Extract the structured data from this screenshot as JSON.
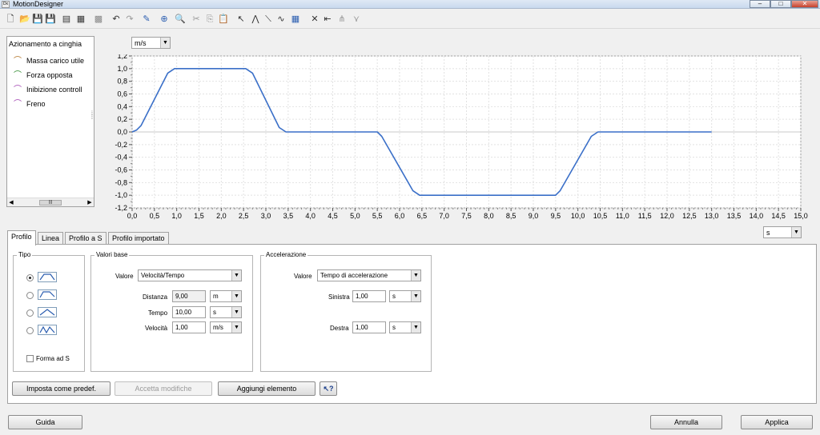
{
  "window": {
    "title": "MotionDesigner"
  },
  "tree": {
    "header": "Azionamento a cinghia",
    "items": [
      {
        "label": "Massa carico utile",
        "color": "#b07020"
      },
      {
        "label": "Forza opposta",
        "color": "#2c8a2c"
      },
      {
        "label": "Inibizione controll",
        "color": "#a040b0"
      },
      {
        "label": "Freno",
        "color": "#a040b0"
      }
    ]
  },
  "unit_select": {
    "value": "m/s"
  },
  "time_unit_select": {
    "value": "s"
  },
  "chart_data": {
    "type": "line",
    "x_ticks": [
      "0,0",
      "0,5",
      "1,0",
      "1,5",
      "2,0",
      "2,5",
      "3,0",
      "3,5",
      "4,0",
      "4,5",
      "5,0",
      "5,5",
      "6,0",
      "6,5",
      "7,0",
      "7,5",
      "8,0",
      "8,5",
      "9,0",
      "9,5",
      "10,0",
      "10,5",
      "11,0",
      "11,5",
      "12,0",
      "12,5",
      "13,0",
      "13,5",
      "14,0",
      "14,5",
      "15,0"
    ],
    "y_ticks": [
      "1,2",
      "1,0",
      "0,8",
      "0,6",
      "0,4",
      "0,2",
      "0,0",
      "-0,2",
      "-0,4",
      "-0,6",
      "-0,8",
      "-1,0",
      "-1,2"
    ],
    "xlim": [
      0,
      15
    ],
    "ylim": [
      -1.2,
      1.2
    ],
    "grid": "dashed",
    "series": [
      {
        "color": "#3a6fc8",
        "x": [
          0,
          0.1,
          0.2,
          0.8,
          0.95,
          1.0,
          2.55,
          2.7,
          3.3,
          3.45,
          3.5,
          5.5,
          5.6,
          6.3,
          6.45,
          6.5,
          9.5,
          9.6,
          10.3,
          10.45,
          10.5,
          13.0
        ],
        "y": [
          0,
          0.03,
          0.1,
          0.93,
          1.0,
          1.0,
          1.0,
          0.93,
          0.07,
          0.0,
          0.0,
          0.0,
          -0.07,
          -0.93,
          -1.0,
          -1.0,
          -1.0,
          -0.93,
          -0.07,
          0.0,
          0.0,
          0.0
        ]
      }
    ]
  },
  "tabs": [
    {
      "label": "Profilo"
    },
    {
      "label": "Linea"
    },
    {
      "label": "Profilo a S"
    },
    {
      "label": "Profilo importato"
    }
  ],
  "tipo": {
    "legend": "Tipo",
    "forma_label": "Forma ad S"
  },
  "valori_base": {
    "legend": "Valori base",
    "valore_label": "Valore",
    "valore_value": "Velocità/Tempo",
    "distanza_label": "Distanza",
    "distanza_value": "9,00",
    "distanza_unit": "m",
    "tempo_label": "Tempo",
    "tempo_value": "10,00",
    "tempo_unit": "s",
    "velocita_label": "Velocità",
    "velocita_value": "1,00",
    "velocita_unit": "m/s"
  },
  "accelerazione": {
    "legend": "Accelerazione",
    "valore_label": "Valore",
    "valore_value": "Tempo di accelerazione",
    "sinistra_label": "Sinistra",
    "sinistra_value": "1,00",
    "sinistra_unit": "s",
    "destra_label": "Destra",
    "destra_value": "1,00",
    "destra_unit": "s"
  },
  "buttons": {
    "default": "Imposta come predef.",
    "accept": "Accetta modifiche",
    "add": "Aggiungi elemento",
    "guida": "Guida",
    "annulla": "Annulla",
    "applica": "Applica"
  }
}
